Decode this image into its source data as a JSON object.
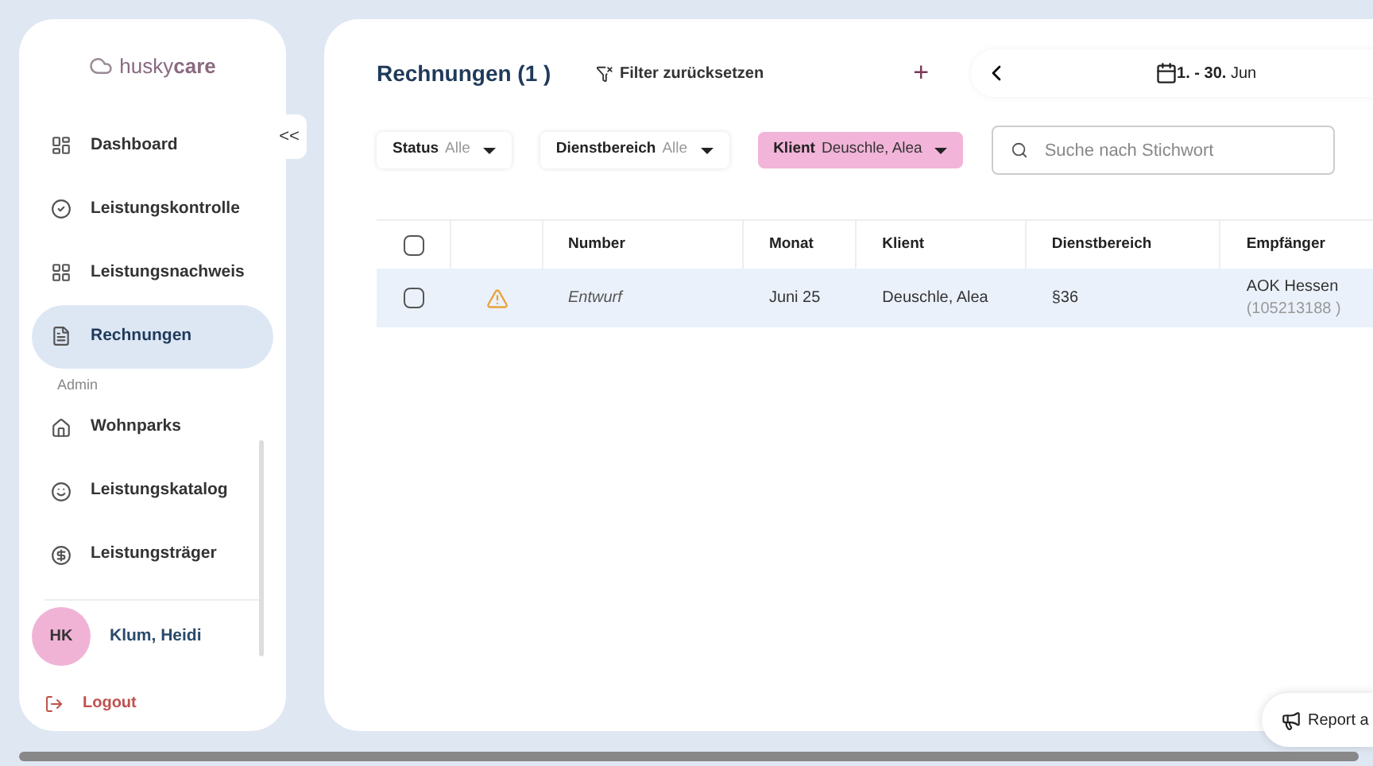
{
  "brand": {
    "part1": "husky",
    "part2": "care"
  },
  "sidebar": {
    "items": [
      {
        "label": "Dashboard",
        "selected": false
      },
      {
        "label": "Leistungskontrolle",
        "selected": false
      },
      {
        "label": "Leistungsnachweis",
        "selected": false
      },
      {
        "label": "Rechnungen",
        "selected": true
      },
      {
        "kind": "section",
        "label": "Admin"
      },
      {
        "label": "Wohnparks",
        "selected": false
      },
      {
        "label": "Leistungskatalog",
        "selected": false
      },
      {
        "label": "Leistungsträger",
        "selected": false
      }
    ],
    "collapse": "<<",
    "user": {
      "initials": "HK",
      "name": "Klum, Heidi"
    },
    "logout": "Logout"
  },
  "header": {
    "title": "Rechnungen (1 )",
    "reset": "Filter zurücksetzen",
    "add": "+",
    "date_bold": "1. - 30.",
    "date_month": "Jun"
  },
  "filters": [
    {
      "label": "Status",
      "value": "Alle",
      "active": false
    },
    {
      "label": "Dienstbereich",
      "value": "Alle",
      "active": false
    },
    {
      "label": "Klient",
      "value": "Deuschle, Alea",
      "active": true
    }
  ],
  "search": {
    "placeholder": "Suche nach Stichwort"
  },
  "table": {
    "select_all_checked": false,
    "columns": [
      "Number",
      "Monat",
      "Klient",
      "Dienstbereich",
      "Empfänger"
    ],
    "rows": [
      {
        "checked": false,
        "warning": true,
        "number": "Entwurf",
        "monat": "Juni 25",
        "klient": "Deuschle, Alea",
        "dienstbereich": "§36",
        "empfaenger": "AOK Hessen",
        "empfaenger_id": "(105213188 )"
      }
    ]
  },
  "report": "Report a"
}
